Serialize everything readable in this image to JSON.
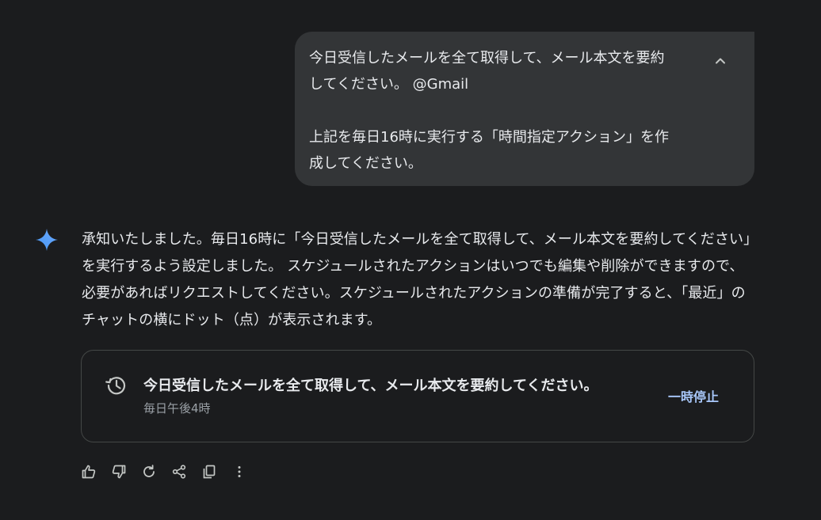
{
  "user_message": {
    "line1": "今日受信したメールを全て取得して、メール本文を要約",
    "line2": "してください。 @Gmail",
    "line3": "上記を毎日16時に実行する「時間指定アクション」を作",
    "line4": "成してください。",
    "collapse_icon": "chevron-up-icon"
  },
  "assistant": {
    "icon": "gemini-sparkle-icon",
    "reply": "承知いたしました。毎日16時に「今日受信したメールを全て取得して、メール本文を要約してください」を実行するよう設定しました。 スケジュールされたアクションはいつでも編集や削除ができますので、必要があればリクエストしてください。スケジュールされたアクションの準備が完了すると、「最近」のチャットの横にドット（点）が表示されます。"
  },
  "scheduled_action": {
    "icon": "history-icon",
    "title": "今日受信したメールを全て取得して、メール本文を要約してください。",
    "schedule": "毎日午後4時",
    "pause_label": "一時停止"
  },
  "response_actions": [
    "thumbs-up-icon",
    "thumbs-down-icon",
    "regenerate-icon",
    "share-icon",
    "copy-icon",
    "more-vert-icon"
  ],
  "colors": {
    "background": "#1b1c1e",
    "user_bubble": "#333537",
    "accent_link": "#a8c7fa",
    "sparkle": "#4796f0"
  }
}
